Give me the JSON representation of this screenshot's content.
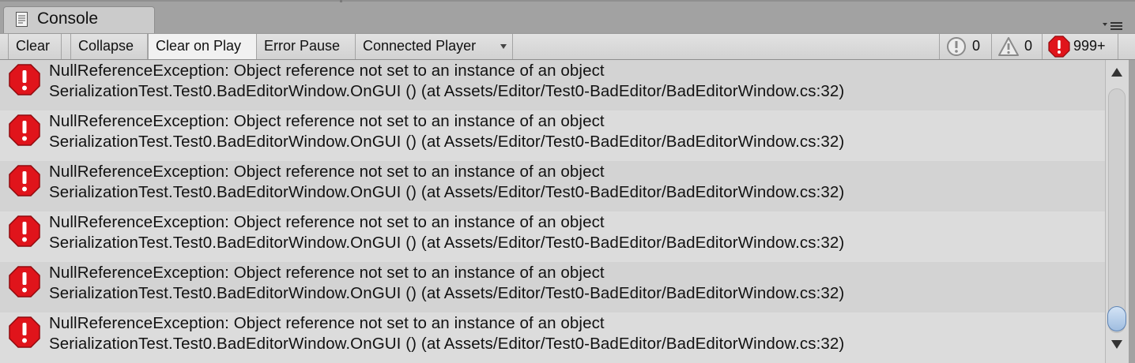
{
  "window": {
    "tab_title": "Console",
    "tab_icon": "console-document-icon",
    "menu_icon": "panel-menu-icon"
  },
  "toolbar": {
    "clear_label": "Clear",
    "collapse_label": "Collapse",
    "clear_on_play_label": "Clear on Play",
    "error_pause_label": "Error Pause",
    "player_dropdown_value": "Connected Player",
    "info_count": "0",
    "warning_count": "0",
    "error_count": "999+"
  },
  "colors": {
    "error_red": "#e0141b",
    "thumb_blue": "#9fbde0"
  },
  "log": {
    "entries": [
      {
        "type": "error",
        "line1": "NullReferenceException: Object reference not set to an instance of an object",
        "line2": "SerializationTest.Test0.BadEditorWindow.OnGUI () (at Assets/Editor/Test0-BadEditor/BadEditorWindow.cs:32)"
      },
      {
        "type": "error",
        "line1": "NullReferenceException: Object reference not set to an instance of an object",
        "line2": "SerializationTest.Test0.BadEditorWindow.OnGUI () (at Assets/Editor/Test0-BadEditor/BadEditorWindow.cs:32)"
      },
      {
        "type": "error",
        "line1": "NullReferenceException: Object reference not set to an instance of an object",
        "line2": "SerializationTest.Test0.BadEditorWindow.OnGUI () (at Assets/Editor/Test0-BadEditor/BadEditorWindow.cs:32)"
      },
      {
        "type": "error",
        "line1": "NullReferenceException: Object reference not set to an instance of an object",
        "line2": "SerializationTest.Test0.BadEditorWindow.OnGUI () (at Assets/Editor/Test0-BadEditor/BadEditorWindow.cs:32)"
      },
      {
        "type": "error",
        "line1": "NullReferenceException: Object reference not set to an instance of an object",
        "line2": "SerializationTest.Test0.BadEditorWindow.OnGUI () (at Assets/Editor/Test0-BadEditor/BadEditorWindow.cs:32)"
      },
      {
        "type": "error",
        "line1": "NullReferenceException: Object reference not set to an instance of an object",
        "line2": "SerializationTest.Test0.BadEditorWindow.OnGUI () (at Assets/Editor/Test0-BadEditor/BadEditorWindow.cs:32)"
      }
    ]
  },
  "scrollbar": {
    "position_fraction": 1.0
  }
}
